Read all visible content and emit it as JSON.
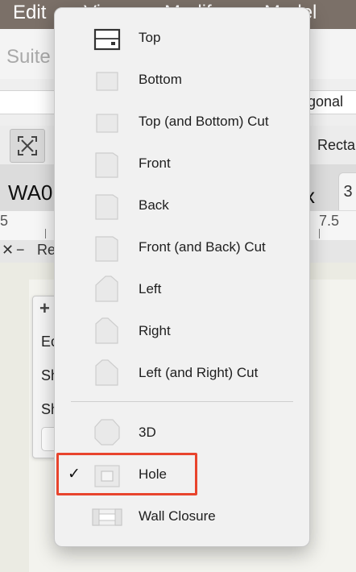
{
  "menubar": {
    "items": [
      "Edit",
      "View",
      "Modify",
      "Model"
    ]
  },
  "toolbar": {
    "suite_title": "Suite",
    "field_value": "gonal",
    "shape_label": "Recta"
  },
  "view_tabs": {
    "current_tab": "WA0",
    "suffix": "x",
    "tab3": "3"
  },
  "ruler": {
    "left_value": "5",
    "right_value": "7.5"
  },
  "subbar": {
    "close_symbol": "✕",
    "minus_symbol": "−",
    "label": "Re"
  },
  "panel": {
    "plus_symbol": "+",
    "row1": "Ec",
    "row2": "Sh",
    "row3": "Sh"
  },
  "menu": {
    "items": [
      {
        "label": "Top",
        "icon": "top-view-icon",
        "checked": false
      },
      {
        "label": "Bottom",
        "icon": "bottom-view-icon",
        "checked": false
      },
      {
        "label": "Top (and Bottom) Cut",
        "icon": "top-bottom-cut-icon",
        "checked": false
      },
      {
        "label": "Front",
        "icon": "front-view-icon",
        "checked": false
      },
      {
        "label": "Back",
        "icon": "back-view-icon",
        "checked": false
      },
      {
        "label": "Front (and Back) Cut",
        "icon": "front-back-cut-icon",
        "checked": false
      },
      {
        "label": "Left",
        "icon": "left-view-icon",
        "checked": false
      },
      {
        "label": "Right",
        "icon": "right-view-icon",
        "checked": false
      },
      {
        "label": "Left (and Right) Cut",
        "icon": "left-right-cut-icon",
        "checked": false
      },
      {
        "label": "3D",
        "icon": "3d-view-icon",
        "checked": false
      },
      {
        "label": "Hole",
        "icon": "hole-view-icon",
        "checked": true
      },
      {
        "label": "Wall Closure",
        "icon": "wall-closure-icon",
        "checked": false
      }
    ],
    "check_mark": "✓"
  },
  "colors": {
    "highlight": "#e8442d",
    "menubar": "#7b7068",
    "menu_bg": "#f1f1f1"
  }
}
